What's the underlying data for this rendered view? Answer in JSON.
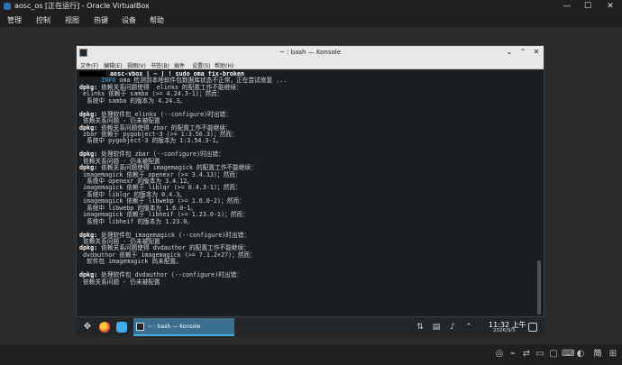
{
  "vbox": {
    "title": "aosc_os [正在运行] - Oracle VirtualBox",
    "controls": {
      "minimize": "—",
      "maximize": "☐",
      "close": "✕"
    },
    "menu": [
      "管理",
      "控制",
      "视图",
      "热键",
      "设备",
      "帮助"
    ],
    "status_icons": [
      "cd-icon",
      "usb-icon",
      "network-icon",
      "disk-icon",
      "display-icon",
      "keyboard-icon",
      "mouse-icon",
      "cpu-icon",
      "folder-icon",
      "shared-icon",
      "vm-icon",
      "arrow-icon"
    ],
    "host_key": "ctrl",
    "ime_label": "简"
  },
  "konsole": {
    "title": "~ : bash — Konsole",
    "menu": [
      "文件(F)",
      "编辑(E)",
      "视图(V)",
      "书签(B)",
      "插件",
      "设置(S)",
      "帮助(H)"
    ],
    "scroll_fraction": 0.22,
    "terminal_lines": [
      {
        "segments": [
          {
            "t": "",
            "redact": true
          },
          {
            "t": " aosc-vbox [ ~ ] ! sudo oma fix-broken",
            "c": "bold"
          }
        ]
      },
      {
        "segments": [
          {
            "t": "      INFO",
            "c": "info"
          },
          {
            "t": " oma 检测到本地软件包数据库状态不正常，正在尝试修复 ..."
          }
        ]
      },
      {
        "segments": [
          {
            "t": "dpkg:",
            "c": "bold"
          },
          {
            "t": " 依赖关系问题使得  elinks 的配置工作不能继续："
          }
        ]
      },
      {
        "segments": [
          {
            "t": " elinks 依赖于 samba (>= 4.24.3-1)；然而："
          }
        ]
      },
      {
        "segments": [
          {
            "t": "  系统中 samba 的版本为 4.24.3。"
          }
        ]
      },
      {
        "segments": [
          {
            "t": ""
          }
        ]
      },
      {
        "segments": [
          {
            "t": "dpkg:",
            "c": "bold"
          },
          {
            "t": " 处理软件包 elinks (--configure)时出错："
          }
        ]
      },
      {
        "segments": [
          {
            "t": " 依赖关系问题 - 仍未被配置"
          }
        ]
      },
      {
        "segments": [
          {
            "t": "dpkg:",
            "c": "bold"
          },
          {
            "t": " 依赖关系问题使得 zbar 的配置工作不能继续："
          }
        ]
      },
      {
        "segments": [
          {
            "t": " zbar 依赖于 pygobject-3 (>= 1:3.56.3)；然而："
          }
        ]
      },
      {
        "segments": [
          {
            "t": "  系统中 pygobject-3 的版本为 1:3.54.3-1。"
          }
        ]
      },
      {
        "segments": [
          {
            "t": ""
          }
        ]
      },
      {
        "segments": [
          {
            "t": "dpkg:",
            "c": "bold"
          },
          {
            "t": " 处理软件包 zbar (--configure)时出错："
          }
        ]
      },
      {
        "segments": [
          {
            "t": " 依赖关系问题 - 仍未被配置"
          }
        ]
      },
      {
        "segments": [
          {
            "t": "dpkg:",
            "c": "bold"
          },
          {
            "t": " 依赖关系问题使得 imagemagick 的配置工作不能继续："
          }
        ]
      },
      {
        "segments": [
          {
            "t": " imagemagick 依赖于 openexr (>= 3.4.13)；然而："
          }
        ]
      },
      {
        "segments": [
          {
            "t": "  系统中 openexr 的版本为 3.4.12。"
          }
        ]
      },
      {
        "segments": [
          {
            "t": " imagemagick 依赖于 liblqr (>= 0.4.3-1)；然而："
          }
        ]
      },
      {
        "segments": [
          {
            "t": "  系统中 liblqr 的版本为 0.4.3。"
          }
        ]
      },
      {
        "segments": [
          {
            "t": " imagemagick 依赖于 libwebp (>= 1.6.0-2)；然而："
          }
        ]
      },
      {
        "segments": [
          {
            "t": "  系统中 libwebp 的版本为 1.6.0-1。"
          }
        ]
      },
      {
        "segments": [
          {
            "t": " imagemagick 依赖于 libheif (>= 1.23.0-1)；然而："
          }
        ]
      },
      {
        "segments": [
          {
            "t": "  系统中 libheif 的版本为 1.23.0。"
          }
        ]
      },
      {
        "segments": [
          {
            "t": ""
          }
        ]
      },
      {
        "segments": [
          {
            "t": "dpkg:",
            "c": "bold"
          },
          {
            "t": " 处理软件包 imagemagick (--configure)时出错："
          }
        ]
      },
      {
        "segments": [
          {
            "t": " 依赖关系问题 - 仍未被配置"
          }
        ]
      },
      {
        "segments": [
          {
            "t": "dpkg:",
            "c": "bold"
          },
          {
            "t": " 依赖关系问题使得 dvdauthor 的配置工作不能继续："
          }
        ]
      },
      {
        "segments": [
          {
            "t": " dvdauthor 依赖于 imagemagick (>= 7.1.2+27)；然而："
          }
        ]
      },
      {
        "segments": [
          {
            "t": "  软件包 imagemagick 尚未配置。"
          }
        ]
      },
      {
        "segments": [
          {
            "t": ""
          }
        ]
      },
      {
        "segments": [
          {
            "t": "dpkg:",
            "c": "bold"
          },
          {
            "t": " 处理软件包 dvdauthor (--configure)时出错："
          }
        ]
      },
      {
        "segments": [
          {
            "t": " 依赖关系问题 - 仍未被配置"
          }
        ]
      }
    ]
  },
  "panel": {
    "task_label": "~ : bash — Konsole",
    "clock_time": "11:32 上午",
    "clock_date": "2026/9/5",
    "launcher_icons": [
      "app-launcher-icon",
      "firefox-icon",
      "file-manager-icon",
      "konsole-icon"
    ],
    "tray_icons": [
      "network-tray-icon",
      "clipboard-tray-icon",
      "volume-tray-icon",
      "expand-tray-icon",
      "show-desktop-icon"
    ]
  },
  "colors": {
    "terminal_bg": "#1b1e20",
    "info": "#2e8bc9",
    "panel_bg": "#232629",
    "task_active": "#3b6e8f"
  }
}
